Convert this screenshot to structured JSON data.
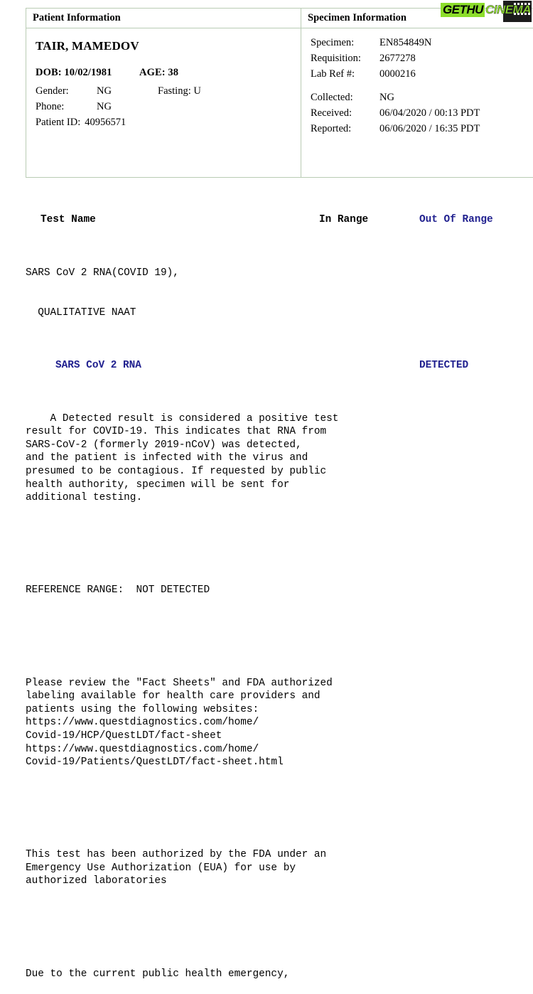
{
  "watermark": {
    "part1": "GETHU",
    "part2": "CINEMA"
  },
  "patient_panel": {
    "header": "Patient Information",
    "name": "TAIR, MAMEDOV",
    "dob_label": "DOB: 10/02/1981",
    "age_label": "AGE: 38",
    "fields": [
      {
        "label": "Gender:",
        "value": "NG",
        "label2": "Fasting: U"
      },
      {
        "label": "Phone:",
        "value": "NG",
        "label2": ""
      }
    ],
    "patient_id_label": "Patient ID:",
    "patient_id_value": "40956571"
  },
  "specimen_panel": {
    "header": "Specimen Information",
    "group1": [
      {
        "label": "Specimen:",
        "value": "EN854849N"
      },
      {
        "label": "Requisition:",
        "value": "2677278"
      },
      {
        "label": "Lab Ref #:",
        "value": "0000216"
      }
    ],
    "group2": [
      {
        "label": "Collected:",
        "value": "NG"
      },
      {
        "label": "Received:",
        "value": "06/04/2020 / 00:13 PDT"
      },
      {
        "label": "Reported:",
        "value": "06/06/2020 / 16:35 PDT"
      }
    ]
  },
  "results": {
    "columns": {
      "test_name": "Test Name",
      "in_range": "In Range",
      "out_of_range": "Out Of Range"
    },
    "test_title_line1": "SARS CoV 2 RNA(COVID 19),",
    "test_title_line2": "  QUALITATIVE NAAT",
    "analyte_name": "SARS CoV 2 RNA",
    "analyte_value": "DETECTED",
    "body_blocks": [
      "    A Detected result is considered a positive test\nresult for COVID-19. This indicates that RNA from\nSARS-CoV-2 (formerly 2019-nCoV) was detected,\nand the patient is infected with the virus and\npresumed to be contagious. If requested by public\nhealth authority, specimen will be sent for\nadditional testing.",
      "REFERENCE RANGE:  NOT DETECTED",
      "Please review the \"Fact Sheets\" and FDA authorized\nlabeling available for health care providers and\npatients using the following websites:\nhttps://www.questdiagnostics.com/home/\nCovid-19/HCP/QuestLDT/fact-sheet\nhttps://www.questdiagnostics.com/home/\nCovid-19/Patients/QuestLDT/fact-sheet.html",
      "This test has been authorized by the FDA under an\nEmergency Use Authorization (EUA) for use by\nauthorized laboratories",
      "Due to the current public health emergency,"
    ]
  },
  "colors": {
    "accent_blue": "#20208f",
    "border_green": "#b9ccb4",
    "watermark_green": "#8cdd2b"
  }
}
